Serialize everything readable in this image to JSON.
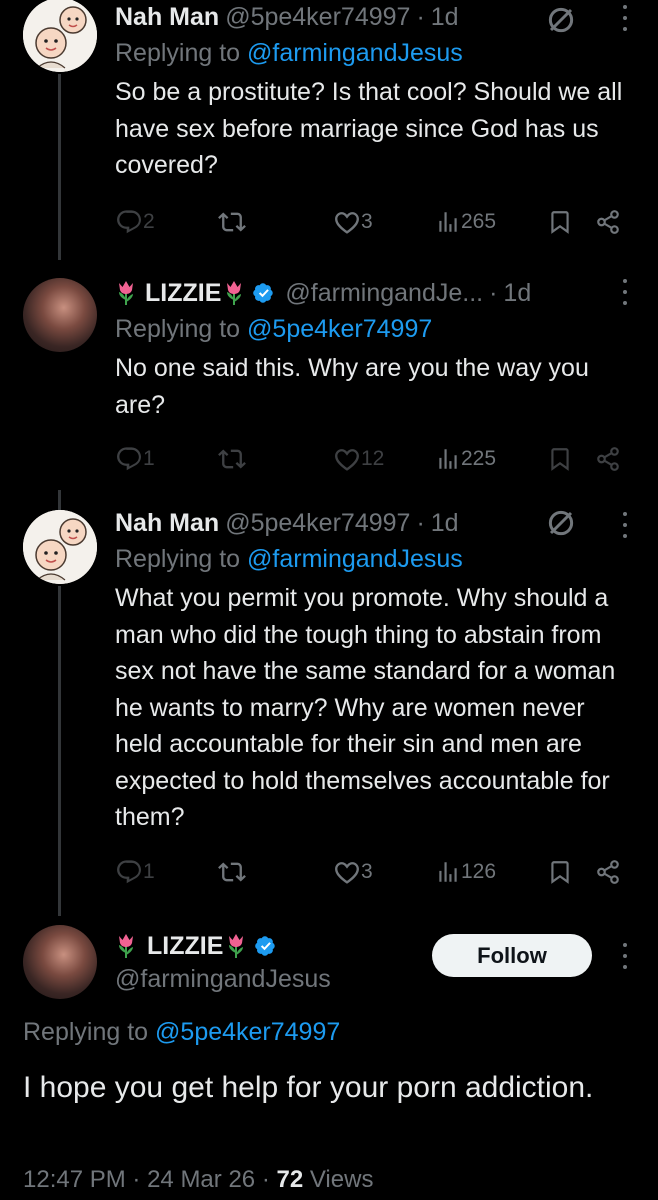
{
  "tweets": [
    {
      "name": "Nah Man",
      "handle": "@5pe4ker74997",
      "time": "1d",
      "reply_prefix": "Replying to",
      "reply_to": "@farmingandJesus",
      "text": "So be a prostitute? Is that cool? Should we all have sex before marriage since God has us covered?",
      "replies": "2",
      "likes": "3",
      "views": "265"
    },
    {
      "name": "LIZZIE",
      "handle": "@farmingandJe...",
      "time": "1d",
      "reply_prefix": "Replying to",
      "reply_to": "@5pe4ker74997",
      "text": "No one said this. Why are you the way you are?",
      "replies": "1",
      "likes": "12",
      "views": "225"
    },
    {
      "name": "Nah Man",
      "handle": "@5pe4ker74997",
      "time": "1d",
      "reply_prefix": "Replying to",
      "reply_to": "@farmingandJesus",
      "text": "What you permit you promote. Why should a man who did the tough thing to abstain from sex not have the same standard for a woman he wants to marry? Why are women never held accountable for their sin and men are expected to hold themselves accountable for them?",
      "replies": "1",
      "likes": "3",
      "views": "126"
    }
  ],
  "main_tweet": {
    "name": "LIZZIE",
    "handle": "@farmingandJesus",
    "follow_label": "Follow",
    "reply_prefix": "Replying to",
    "reply_to": "@5pe4ker74997",
    "text": "I hope you get help for your porn addiction.",
    "time": "12:47 PM",
    "date": "24 Mar 26",
    "views_count": "72",
    "views_label": "Views"
  },
  "separator": "·",
  "icons": [
    "reply-icon",
    "retweet-icon",
    "like-icon",
    "views-icon",
    "bookmark-icon",
    "share-icon",
    "more-icon",
    "verified-badge-icon",
    "tulip-emoji-icon",
    "mute-icon"
  ],
  "colors": {
    "background": "#000000",
    "text": "#e7e9ea",
    "muted": "#71767b",
    "link": "#1d9bf0",
    "verified": "#1d9bf0",
    "follow_bg": "#eff3f4"
  }
}
